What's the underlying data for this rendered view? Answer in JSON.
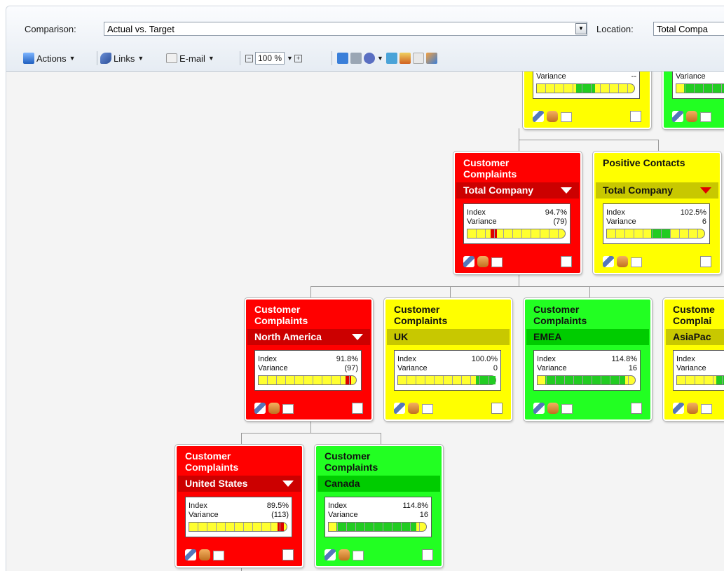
{
  "header": {
    "comparison_label": "Comparison:",
    "comparison_value": "Actual vs. Target",
    "location_label": "Location:",
    "location_value": "Total Compa"
  },
  "toolbar": {
    "actions_label": "Actions",
    "links_label": "Links",
    "email_label": "E-mail",
    "zoom_value": "100 %"
  },
  "colors": {
    "red": "#ff0000",
    "yellow": "#ffff00",
    "green": "#22ff22",
    "band_red": "#cc0000",
    "band_yellow": "#c8c800",
    "band_green": "#00cc00"
  },
  "cards": [
    {
      "title": "",
      "title2": "",
      "location": "",
      "index": "",
      "variance": "--",
      "status": "yellow",
      "fill": 0.5
    },
    {
      "title": "",
      "title2": "",
      "location": "",
      "index": "",
      "variance": "",
      "status": "green",
      "fill": 0.7
    },
    {
      "title": "Customer",
      "title2": "Complaints",
      "location": "Total Company",
      "index": "94.7%",
      "variance": "(79)",
      "status": "red",
      "fill": 0.3
    },
    {
      "title": "Positive Contacts",
      "title2": "",
      "location": "Total Company",
      "index": "102.5%",
      "variance": "6",
      "status": "yellow",
      "fill": 0.55
    },
    {
      "title": "Customer",
      "title2": "Complaints",
      "location": "North America",
      "index": "91.8%",
      "variance": "(97)",
      "status": "red",
      "fill": 0.95
    },
    {
      "title": "Customer",
      "title2": "Complaints",
      "location": "UK",
      "index": "100.0%",
      "variance": "0",
      "status": "yellow",
      "fill": 0.9
    },
    {
      "title": "Customer",
      "title2": "Complaints",
      "location": "EMEA",
      "index": "114.8%",
      "variance": "16",
      "status": "green",
      "fill": 0.9
    },
    {
      "title": "Custome",
      "title2": "Complai",
      "location": "AsiaPac",
      "index": "",
      "variance": "",
      "status": "yellow",
      "fill": 0.5
    },
    {
      "title": "Customer",
      "title2": "Complaints",
      "location": "United States",
      "index": "89.5%",
      "variance": "(113)",
      "status": "red",
      "fill": 0.97
    },
    {
      "title": "Customer",
      "title2": "Complaints",
      "location": "Canada",
      "index": "114.8%",
      "variance": "16",
      "status": "green",
      "fill": 0.9
    }
  ],
  "labels": {
    "index": "Index",
    "variance": "Variance"
  }
}
